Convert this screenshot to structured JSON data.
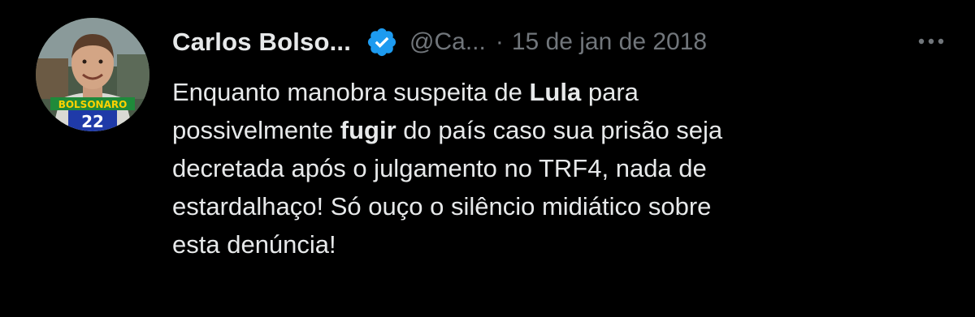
{
  "tweet": {
    "display_name": "Carlos Bolso...",
    "handle": "@Ca...",
    "separator": "·",
    "timestamp": "15 de jan de 2018",
    "avatar_badge": {
      "banner_text": "BOLSONARO",
      "number": "22"
    },
    "text_parts": {
      "p1": "Enquanto manobra suspeita de ",
      "b1": "Lula",
      "p2": " para",
      "p3": "possivelmente ",
      "b2": "fugir",
      "p4": " do país caso sua prisão seja",
      "p5": "decretada após o julgamento no TRF4, nada de",
      "p6": "estardalhaço! Só ouço o silêncio midiático sobre",
      "p7": "esta denúncia!"
    }
  },
  "icons": {
    "verified": "verified-badge-icon",
    "more": "more-options-icon"
  },
  "colors": {
    "background": "#000000",
    "text_primary": "#e7e9ea",
    "text_secondary": "#71767b",
    "verified_blue": "#1d9bf0"
  }
}
